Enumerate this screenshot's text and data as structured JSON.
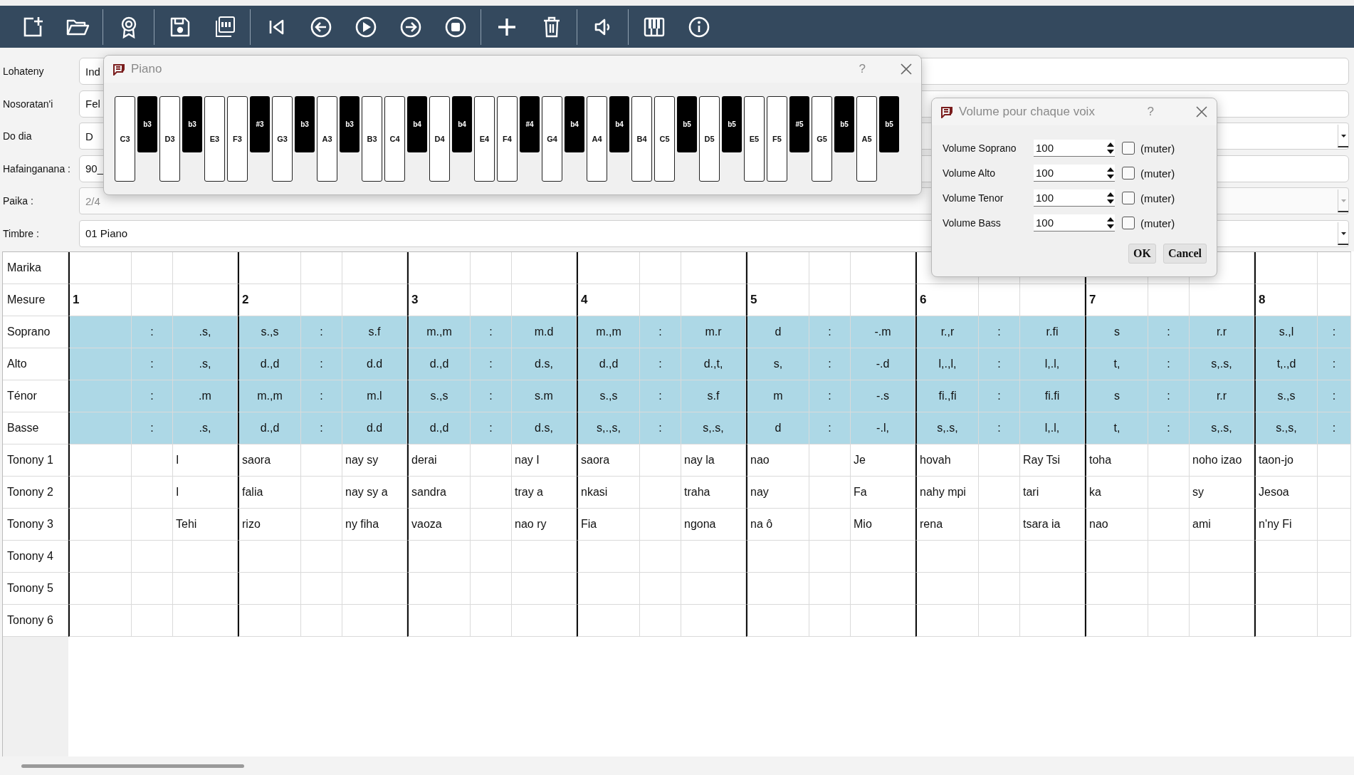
{
  "form": [
    {
      "label": "Lohateny",
      "value": "Ind",
      "kind": "text",
      "disabled": false
    },
    {
      "label": "Nosoratan'i",
      "value": "Fel",
      "kind": "text",
      "disabled": false
    },
    {
      "label": "Do dia",
      "value": "D",
      "kind": "combo",
      "disabled": false
    },
    {
      "label": "Hafainganana :",
      "value": "90_",
      "kind": "text",
      "disabled": false
    },
    {
      "label": "Paika :",
      "value": "2/4",
      "kind": "combo",
      "disabled": true
    },
    {
      "label": "Timbre :",
      "value": "01 Piano",
      "kind": "combo",
      "disabled": false
    }
  ],
  "score": {
    "rows": [
      {
        "label": "Marika",
        "kind": "marks"
      },
      {
        "label": "Mesure",
        "kind": "measure",
        "cells": [
          "1",
          null,
          null,
          "2",
          null,
          null,
          "3",
          null,
          null,
          "4",
          null,
          null,
          "5",
          null,
          null,
          "6",
          null,
          null,
          "7",
          null,
          null,
          "8",
          null
        ]
      },
      {
        "label": "Soprano",
        "kind": "voice",
        "cells": [
          null,
          ":",
          ".s,",
          "s.,s",
          ":",
          "s.f",
          "m.,m",
          ":",
          "m.d",
          "m.,m",
          ":",
          "m.r",
          "d",
          ":",
          "-.m",
          "r.,r",
          ":",
          "r.fi",
          "s",
          ":",
          "r.r",
          "s.,l",
          ":"
        ]
      },
      {
        "label": "Alto",
        "kind": "voice",
        "cells": [
          null,
          ":",
          ".s,",
          "d.,d",
          ":",
          "d.d",
          "d.,d",
          ":",
          "d.s,",
          "d.,d",
          ":",
          "d.,t,",
          "s,",
          ":",
          "-.d",
          "l,.,l,",
          ":",
          "l,.l,",
          "t,",
          ":",
          "s,.s,",
          "t,.,d",
          ":"
        ]
      },
      {
        "label": "Ténor",
        "kind": "voice",
        "cells": [
          null,
          ":",
          ".m",
          "m.,m",
          ":",
          "m.l",
          "s.,s",
          ":",
          "s.m",
          "s.,s",
          ":",
          "s.f",
          "m",
          ":",
          "-.s",
          "fi.,fi",
          ":",
          "fi.fi",
          "s",
          ":",
          "r.r",
          "s.,s",
          ":"
        ]
      },
      {
        "label": "Basse",
        "kind": "voice",
        "cells": [
          null,
          ":",
          ".s,",
          "d.,d",
          ":",
          "d.d",
          "d.,d",
          ":",
          "d.s,",
          "s,.,s,",
          ":",
          "s,.s,",
          "d",
          ":",
          "-.l,",
          "s,.s,",
          ":",
          "l,.l,",
          "t,",
          ":",
          "s,.s,",
          "s.,s,",
          ":"
        ]
      },
      {
        "label": "Tonony 1",
        "kind": "lyrics",
        "cells": [
          null,
          null,
          "I",
          "saora",
          null,
          "nay sy",
          "derai",
          null,
          "nay I",
          "saora",
          null,
          "nay la",
          "nao",
          null,
          "Je",
          "hovah",
          null,
          "Ray Tsi",
          "toha",
          null,
          "noho izao",
          "taon-jo",
          null
        ]
      },
      {
        "label": "Tonony 2",
        "kind": "lyrics",
        "cells": [
          null,
          null,
          "I",
          "falia",
          null,
          "nay sy a",
          "sandra",
          null,
          "tray a",
          "nkasi",
          null,
          "traha",
          "nay",
          null,
          "Fa",
          "nahy mpi",
          null,
          "tari",
          "ka",
          null,
          "sy",
          "Jesoa",
          null
        ]
      },
      {
        "label": "Tonony 3",
        "kind": "lyrics",
        "cells": [
          null,
          null,
          "Tehi",
          "rizo",
          null,
          "ny fiha",
          "vaoza",
          null,
          "nao ry",
          "Fia",
          null,
          "ngona",
          "na ô",
          null,
          "Mio",
          "rena",
          null,
          "tsara ia",
          "nao",
          null,
          "ami",
          "n'ny Fi",
          null
        ]
      },
      {
        "label": "Tonony 4",
        "kind": "lyrics"
      },
      {
        "label": "Tonony 5",
        "kind": "lyrics"
      },
      {
        "label": "Tonony 6",
        "kind": "lyrics"
      }
    ]
  },
  "piano": {
    "title": "Piano",
    "help": "?",
    "keys": [
      {
        "label": "C3",
        "kind": "white"
      },
      {
        "label": "b3",
        "kind": "black"
      },
      {
        "label": "D3",
        "kind": "white"
      },
      {
        "label": "b3",
        "kind": "black"
      },
      {
        "label": "E3",
        "kind": "white"
      },
      {
        "label": "F3",
        "kind": "white"
      },
      {
        "label": "#3",
        "kind": "black"
      },
      {
        "label": "G3",
        "kind": "white"
      },
      {
        "label": "b3",
        "kind": "black"
      },
      {
        "label": "A3",
        "kind": "white"
      },
      {
        "label": "b3",
        "kind": "black"
      },
      {
        "label": "B3",
        "kind": "white"
      },
      {
        "label": "C4",
        "kind": "white"
      },
      {
        "label": "b4",
        "kind": "black"
      },
      {
        "label": "D4",
        "kind": "white"
      },
      {
        "label": "b4",
        "kind": "black"
      },
      {
        "label": "E4",
        "kind": "white"
      },
      {
        "label": "F4",
        "kind": "white"
      },
      {
        "label": "#4",
        "kind": "black"
      },
      {
        "label": "G4",
        "kind": "white"
      },
      {
        "label": "b4",
        "kind": "black"
      },
      {
        "label": "A4",
        "kind": "white"
      },
      {
        "label": "b4",
        "kind": "black"
      },
      {
        "label": "B4",
        "kind": "white"
      },
      {
        "label": "C5",
        "kind": "white"
      },
      {
        "label": "b5",
        "kind": "black"
      },
      {
        "label": "D5",
        "kind": "white"
      },
      {
        "label": "b5",
        "kind": "black"
      },
      {
        "label": "E5",
        "kind": "white"
      },
      {
        "label": "F5",
        "kind": "white"
      },
      {
        "label": "#5",
        "kind": "black"
      },
      {
        "label": "G5",
        "kind": "white"
      },
      {
        "label": "b5",
        "kind": "black"
      },
      {
        "label": "A5",
        "kind": "white"
      },
      {
        "label": "b5",
        "kind": "black"
      }
    ]
  },
  "volume_dialog": {
    "title": "Volume pour chaque voix",
    "help": "?",
    "voices": [
      {
        "label": "Volume Soprano",
        "value": "100",
        "muted": false,
        "mute_label": "(muter)"
      },
      {
        "label": "Volume Alto",
        "value": "100",
        "muted": false,
        "mute_label": "(muter)"
      },
      {
        "label": "Volume Tenor",
        "value": "100",
        "muted": false,
        "mute_label": "(muter)"
      },
      {
        "label": "Volume Bass",
        "value": "100",
        "muted": false,
        "mute_label": "(muter)"
      }
    ],
    "buttons": [
      "OK",
      "Cancel"
    ]
  }
}
